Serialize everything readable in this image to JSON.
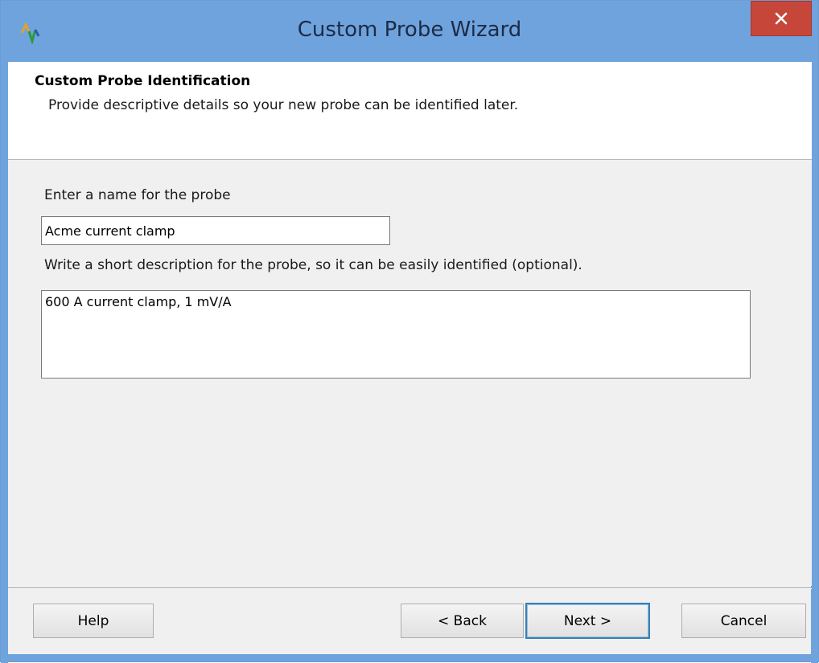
{
  "window": {
    "title": "Custom Probe Wizard"
  },
  "header": {
    "title": "Custom Probe Identification",
    "subtitle": "Provide descriptive details so your new probe can be identified later."
  },
  "form": {
    "name_label": "Enter a name for the probe",
    "name_value": "Acme current clamp",
    "description_label": "Write a short description for the probe, so it can be easily identified (optional).",
    "description_value": "600 A current clamp, 1 mV/A"
  },
  "buttons": {
    "help": "Help",
    "back": "< Back",
    "next": "Next >",
    "cancel": "Cancel"
  },
  "colors": {
    "titlebar": "#6fa3dd",
    "close": "#c7463a"
  }
}
